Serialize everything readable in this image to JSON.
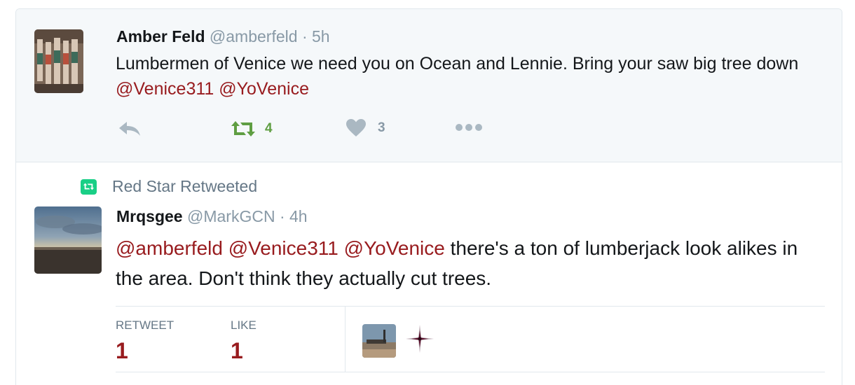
{
  "tweet1": {
    "author_name": "Amber Feld",
    "author_handle": "@amberfeld",
    "separator": "·",
    "time": "5h",
    "text_plain": "Lumbermen of Venice we need you on Ocean and Lennie. Bring your saw big tree down",
    "mentions": [
      "@Venice311",
      "@YoVenice"
    ],
    "retweet_count": "4",
    "like_count": "3"
  },
  "retweet_context": {
    "label": "Red Star Retweeted"
  },
  "tweet2": {
    "author_name": "Mrqsgee",
    "author_handle": "@MarkGCN",
    "separator": "·",
    "time": "4h",
    "mentions": [
      "@amberfeld",
      "@Venice311",
      "@YoVenice"
    ],
    "text_plain": "there's a ton of lumberjack look alikes in the area. Don't think they actually cut trees.",
    "stats": {
      "retweet_label": "RETWEET",
      "retweet_count": "1",
      "like_label": "LIKE",
      "like_count": "1"
    }
  },
  "colors": {
    "mention": "#981b1e",
    "retweet_green": "#19cf86",
    "retweet_action_green": "#5f9e42",
    "muted": "#8899a6",
    "background_highlight": "#f5f8fa"
  },
  "icons": [
    "reply-icon",
    "retweet-icon",
    "heart-icon",
    "more-icon",
    "retweeted-badge-icon",
    "sparkle-avatar-icon"
  ]
}
